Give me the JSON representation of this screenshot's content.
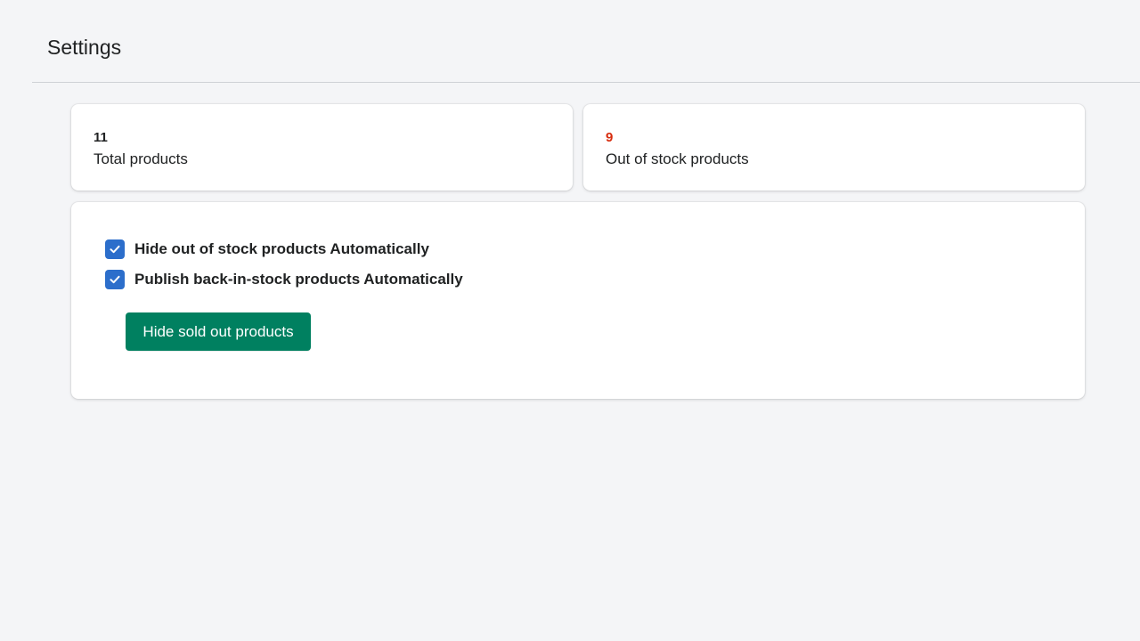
{
  "header": {
    "title": "Settings"
  },
  "stats": {
    "total": {
      "value": "11",
      "label": "Total products",
      "value_color": "#202223"
    },
    "out_of_stock": {
      "value": "9",
      "label": "Out of stock products",
      "value_color": "#d72c0d"
    }
  },
  "settings": {
    "options": [
      {
        "label": "Hide out of stock products Automatically",
        "checked": true
      },
      {
        "label": "Publish back-in-stock products Automatically",
        "checked": true
      }
    ],
    "button_label": "Hide sold out products"
  },
  "colors": {
    "accent": "#008060",
    "checkbox": "#2c6ecb",
    "background": "#f4f5f7"
  }
}
